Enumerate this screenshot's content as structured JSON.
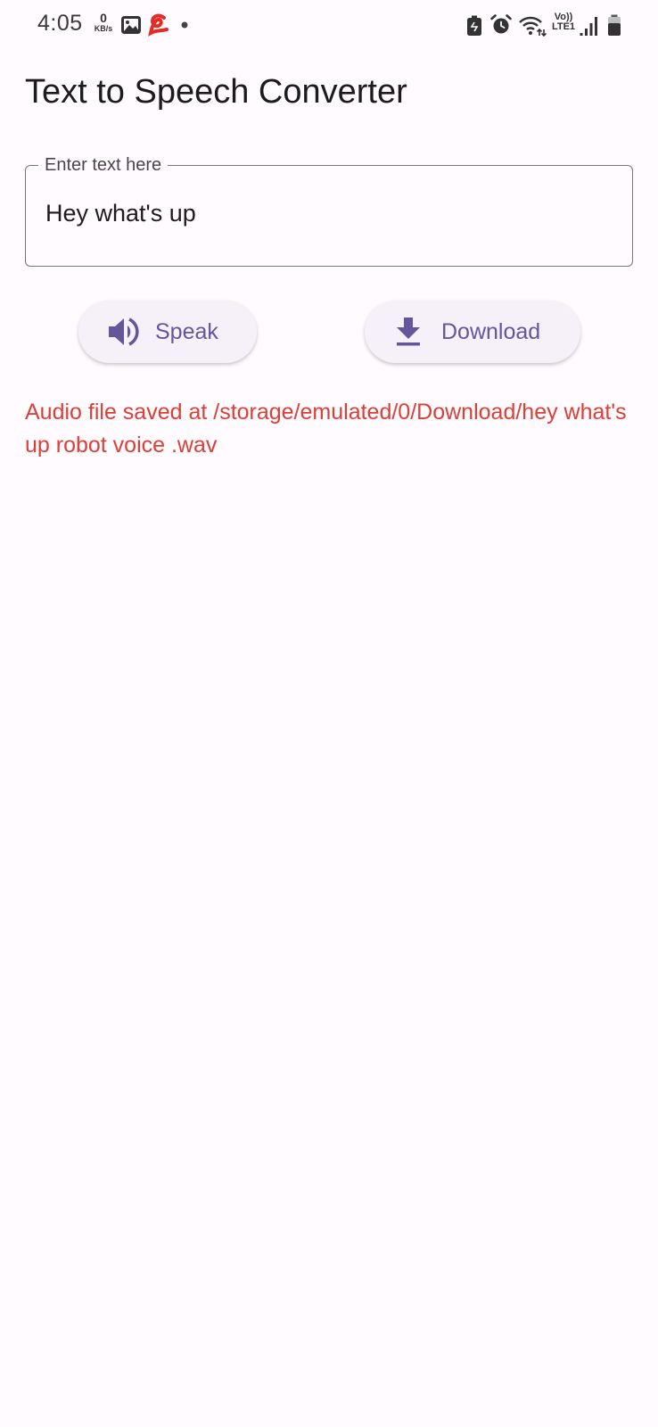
{
  "status_bar": {
    "time": "4:05",
    "net_speed_value": "0",
    "net_speed_unit": "KB/s",
    "network_type": "Vo))\nLTE1",
    "icons": [
      "gallery-icon",
      "airtel-icon",
      "notification-dot-icon",
      "battery-saver-icon",
      "alarm-icon",
      "wifi-icon",
      "signal-icon",
      "battery-icon"
    ]
  },
  "app": {
    "title": "Text to Speech Converter"
  },
  "text_field": {
    "label": "Enter text here",
    "value": "Hey what's up"
  },
  "buttons": {
    "speak": {
      "label": "Speak",
      "icon": "speaker-icon"
    },
    "download": {
      "label": "Download",
      "icon": "download-icon"
    }
  },
  "message": {
    "text": "Audio file saved at /storage/emulated/0/Download/hey what's up robot voice .wav"
  },
  "colors": {
    "background": "#fffbfe",
    "primary": "#65559a",
    "button_bg": "#f6f1f8",
    "message": "#dc3f36",
    "outline": "#79747e"
  }
}
